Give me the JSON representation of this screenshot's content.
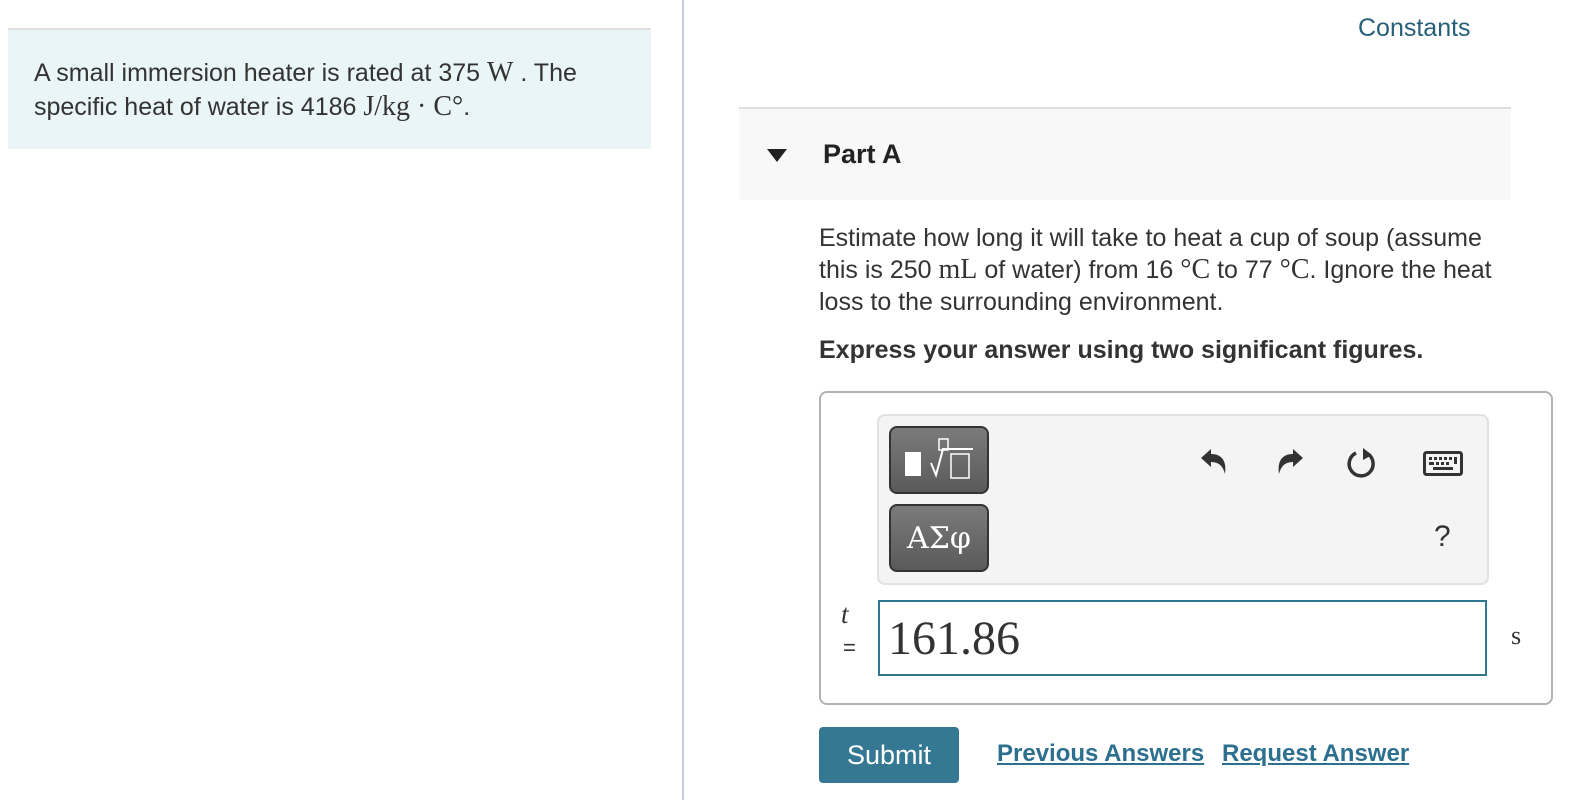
{
  "problem": {
    "intro_1": "A small immersion heater is rated at 375 ",
    "power_unit": "W",
    "intro_2": " . The specific heat of water is 4186 ",
    "heat_unit": "J/kg · C°",
    "intro_3": "."
  },
  "header": {
    "constants_link": "Constants"
  },
  "part": {
    "title": "Part A",
    "question": {
      "t1": "Estimate how long it will take to heat a cup of soup (assume this is 250 ",
      "vol_unit": "mL",
      "t2": " of water) from 16 ",
      "temp_unit_1": "°C",
      "t3": " to 77 ",
      "temp_unit_2": "°C",
      "t4": ". Ignore the heat loss to the surrounding environment."
    },
    "instruction": "Express your answer using two significant figures."
  },
  "toolbar": {
    "greek_label": "ΑΣφ",
    "help_label": "?",
    "icons": [
      "templates-icon",
      "greek-letters-icon",
      "undo-icon",
      "redo-icon",
      "reset-icon",
      "keyboard-icon",
      "help-icon"
    ]
  },
  "answer": {
    "variable": "t",
    "equals": "=",
    "value": "161.86",
    "unit": "s"
  },
  "actions": {
    "submit": "Submit",
    "previous_answers": "Previous Answers",
    "request_answer": "Request Answer"
  }
}
